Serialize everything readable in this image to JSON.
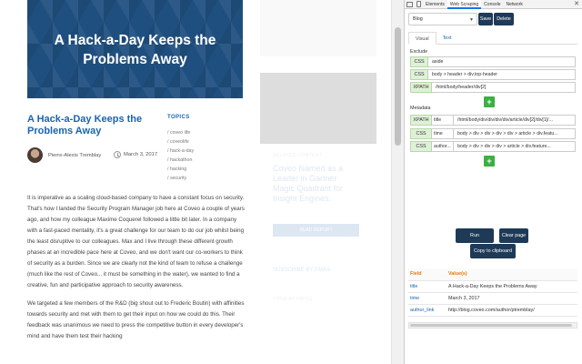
{
  "article": {
    "hero_title": "A Hack-a-Day Keeps the Problems Away",
    "title": "A Hack-a-Day Keeps the Problems Away",
    "author": "Pierre-Alexis Tremblay",
    "date": "March 3, 2017",
    "topics_heading": "TOPICS",
    "topics": [
      "/ coveo life",
      "/ coveolife",
      "/ hack-a-day",
      "/ hackathon",
      "/ hacking",
      "/ security"
    ],
    "paragraphs": [
      "It is imperative as a scaling cloud-based company to have a constant focus on security. That's how I landed the Security Program Manager job here at Coveo a couple of years ago, and how my colleague Maxime Coquerel followed a little bit later. In a company with a fast-paced mentality, it's a great challenge for our team to do our job whilst being the least disruptive to our colleagues. Max and I live through these different growth phases at an incredible pace here at Coveo, and we don't want our co-workers to think of security as a burden. Since we are clearly not the kind of team to refuse a challenge (much like the rest of Coveo... it must be something in the water), we wanted to find a creative, fun and participative approach to security awareness.",
      "We targeted a few members of the R&D (big shout out to Frederic Boutin) with affinities towards security and met with them to get their input on how we could do this. Their feedback was unanimous we need to press the competitive button in every developer's mind and have them test their hacking"
    ]
  },
  "sidebar": {
    "related_heading": "RELATED CONTENT",
    "promo_title": "Coveo Named as a Leader in Gartner Magic Quadrant for Insight Engines.",
    "read_button": "READ REPORT",
    "subscribe": "SUBSCRIBE BY EMAIL",
    "popular_heading": "POPULAR TOPICS"
  },
  "devtools": {
    "tabs": [
      "Elements",
      "Web Scraping",
      "Console",
      "Network"
    ],
    "active_tab": "Web Scraping",
    "close_icon": "close-icon",
    "sitemap_select": "Blog",
    "save_label": "Save",
    "delete_label": "Delete",
    "mode_tabs": [
      "Visual",
      "Text"
    ],
    "exclude_label": "Exclude",
    "exclude_rows": [
      {
        "type": "CSS",
        "path": "aside"
      },
      {
        "type": "CSS",
        "path": "body > header > div.top-header"
      },
      {
        "type": "XPATH",
        "path": "/html/body/header/div[2]"
      }
    ],
    "metadata_label": "Metadata",
    "metadata_rows": [
      {
        "type": "XPATH",
        "name": "title",
        "path": "/html/body/div/div/div/div/article/div[2]/div[1]/..."
      },
      {
        "type": "CSS",
        "name": "time",
        "path": "body > div > div > div > div > article > div.featu..."
      },
      {
        "type": "CSS",
        "name": "author...",
        "path": "body > div > div > div > article > div.feature..."
      }
    ],
    "add_label": "+",
    "run_label": "Run",
    "clear_label": "Clear page",
    "copy_label": "Copy to clipboard",
    "results": {
      "headers": [
        "Field",
        "Value(s)"
      ],
      "rows": [
        {
          "field": "title",
          "value": "A Hack-a-Day Keeps the Problems Away"
        },
        {
          "field": "time",
          "value": "March 3, 2017"
        },
        {
          "field": "author_link",
          "value": "http://blog.coveo.com/author/ptremblay/"
        }
      ]
    }
  },
  "colors": {
    "hero_bg": "#1f4f7f",
    "link_blue": "#1a64b0",
    "dark_button": "#1e3a57",
    "add_green": "#3cb043",
    "css_type_bg": "#dff0d8",
    "results_header": "#e07a10"
  }
}
